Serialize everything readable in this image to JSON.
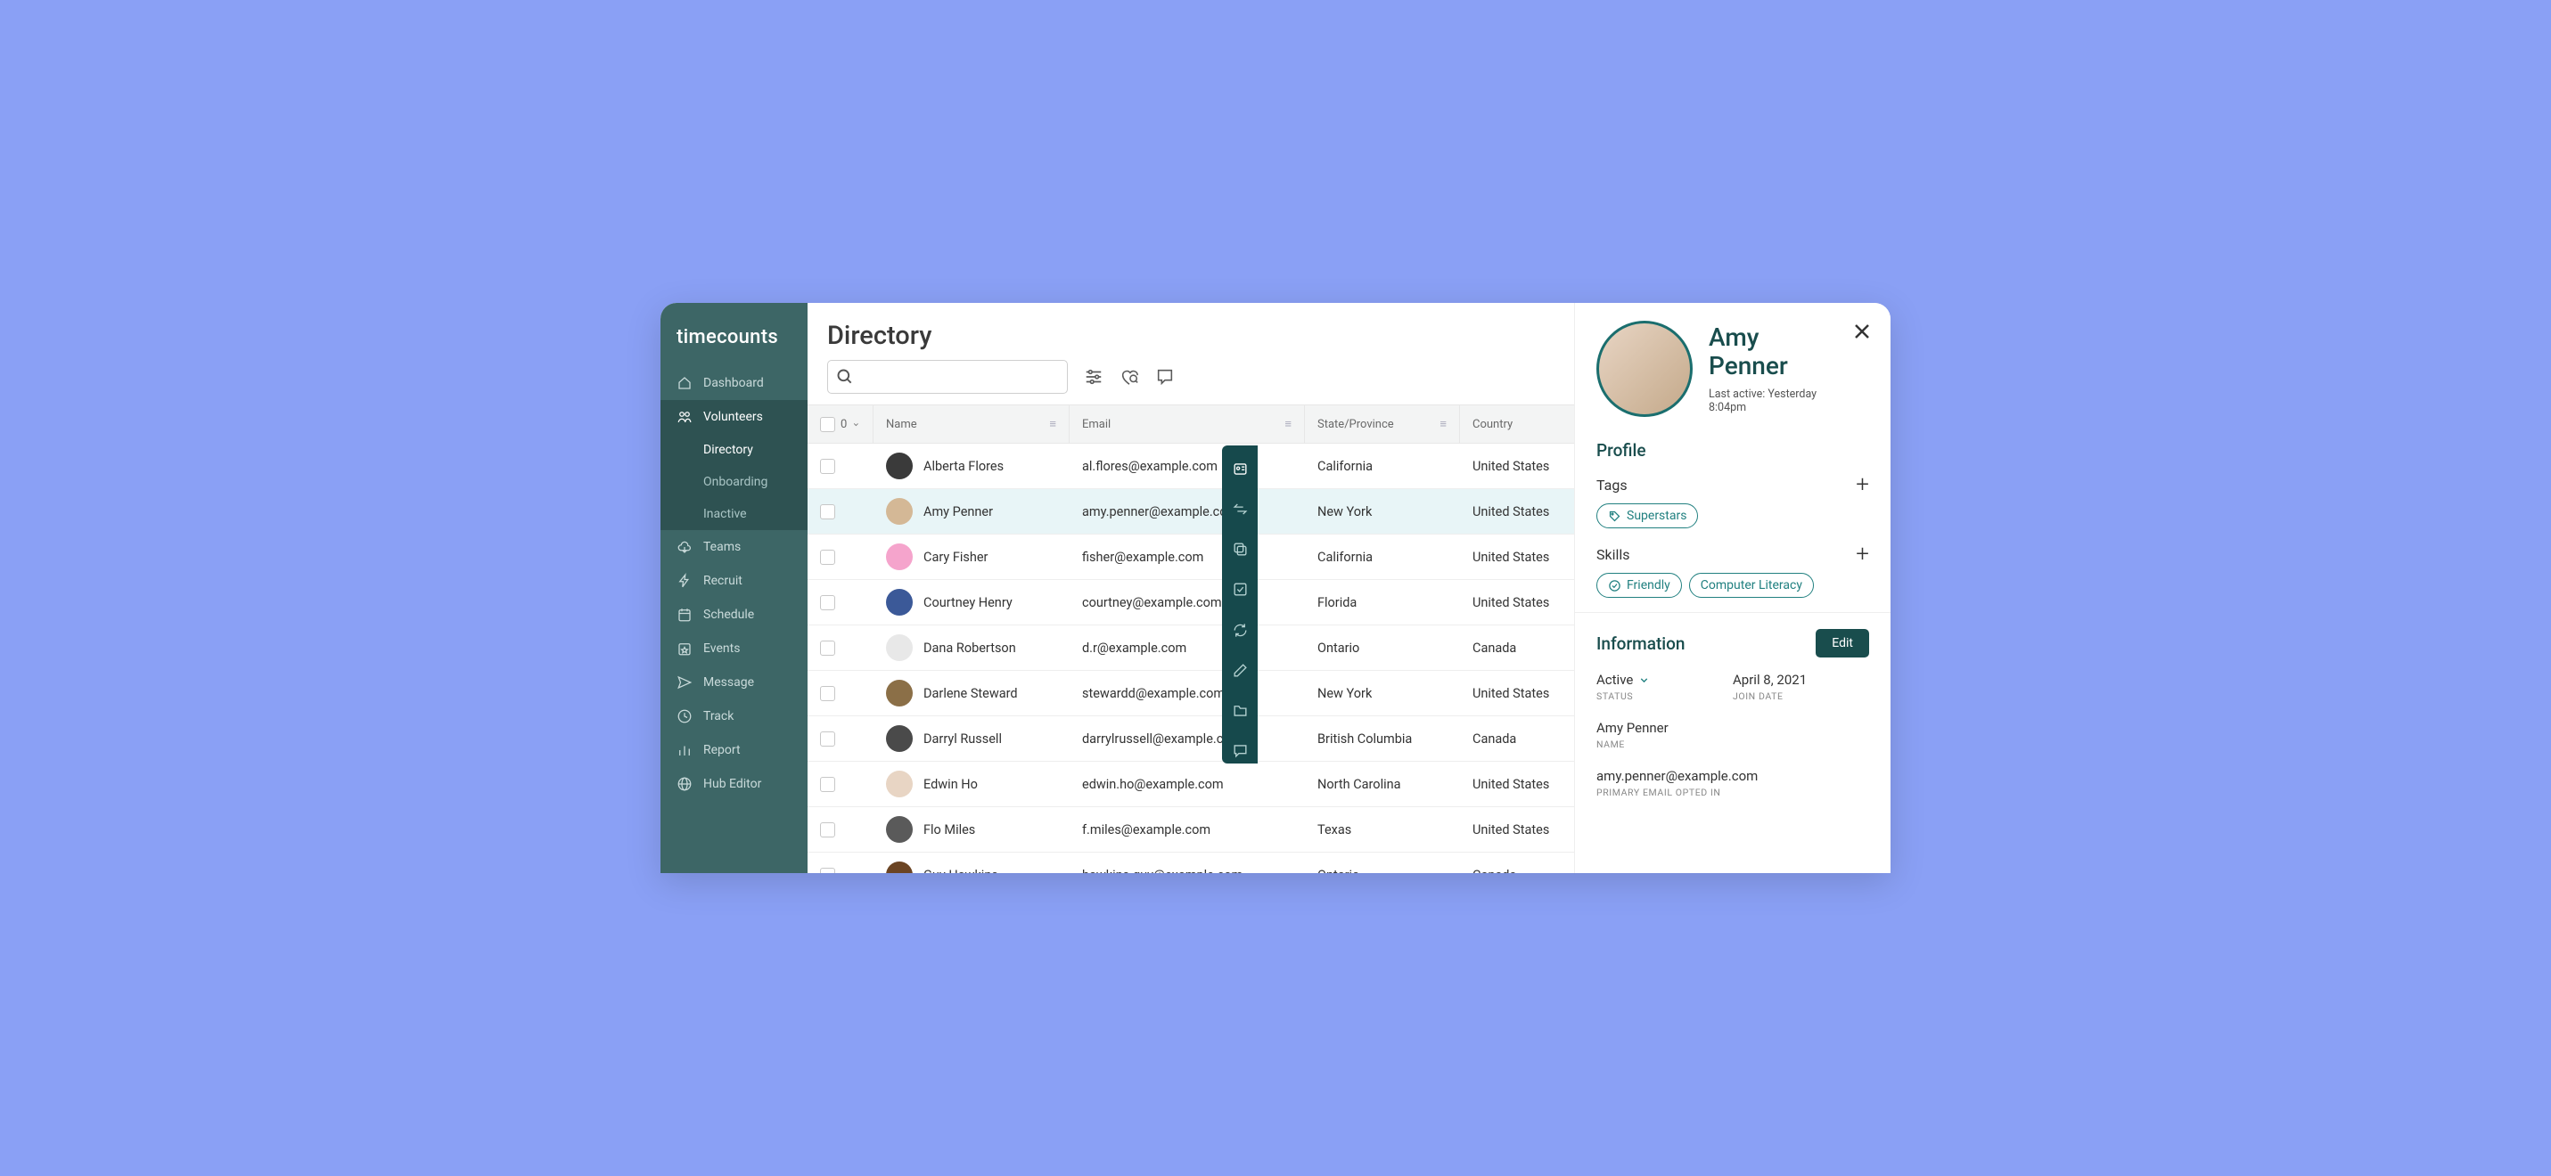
{
  "brand": "timecounts",
  "sidebar": {
    "items": [
      {
        "label": "Dashboard",
        "icon": "home"
      },
      {
        "label": "Volunteers",
        "icon": "users",
        "active": true,
        "sub": [
          {
            "label": "Directory",
            "selected": true
          },
          {
            "label": "Onboarding"
          },
          {
            "label": "Inactive"
          }
        ]
      },
      {
        "label": "Teams",
        "icon": "cloud"
      },
      {
        "label": "Recruit",
        "icon": "bolt"
      },
      {
        "label": "Schedule",
        "icon": "calendar"
      },
      {
        "label": "Events",
        "icon": "star-cal"
      },
      {
        "label": "Message",
        "icon": "send"
      },
      {
        "label": "Track",
        "icon": "clock"
      },
      {
        "label": "Report",
        "icon": "chart"
      },
      {
        "label": "Hub Editor",
        "icon": "globe"
      }
    ]
  },
  "page": {
    "title": "Directory",
    "selected_count": "0"
  },
  "columns": [
    "Name",
    "Email",
    "State/Province",
    "Country"
  ],
  "rows": [
    {
      "name": "Alberta Flores",
      "email": "al.flores@example.com",
      "state": "California",
      "country": "United States",
      "av": "#3a3a3a"
    },
    {
      "name": "Amy Penner",
      "email": "amy.penner@example.com",
      "state": "New York",
      "country": "United States",
      "selected": true,
      "av": "#d4b896"
    },
    {
      "name": "Cary Fisher",
      "email": "fisher@example.com",
      "state": "California",
      "country": "United States",
      "av": "#f5a4cc"
    },
    {
      "name": "Courtney Henry",
      "email": "courtney@example.com",
      "state": "Florida",
      "country": "United States",
      "av": "#3b5998"
    },
    {
      "name": "Dana Robertson",
      "email": "d.r@example.com",
      "state": "Ontario",
      "country": "Canada",
      "av": "#e8e8e8"
    },
    {
      "name": "Darlene Steward",
      "email": "stewardd@example.com",
      "state": "New York",
      "country": "United States",
      "av": "#8b6f47"
    },
    {
      "name": "Darryl Russell",
      "email": "darrylrussell@example.com",
      "state": "British Columbia",
      "country": "Canada",
      "av": "#4a4a4a"
    },
    {
      "name": "Edwin Ho",
      "email": "edwin.ho@example.com",
      "state": "North Carolina",
      "country": "United States",
      "av": "#e8d5c4"
    },
    {
      "name": "Flo Miles",
      "email": "f.miles@example.com",
      "state": "Texas",
      "country": "United States",
      "av": "#5a5a5a"
    },
    {
      "name": "Guy Hawkins",
      "email": "hawkins.guy@example.com",
      "state": "Ontario",
      "country": "Canada",
      "av": "#6b4423"
    }
  ],
  "rail": [
    "id-card",
    "swap",
    "copy",
    "check-sq",
    "refresh",
    "edit",
    "folder",
    "chat"
  ],
  "panel": {
    "name_first": "Amy",
    "name_last": "Penner",
    "last_active_label": "Last active: Yesterday 8:04pm",
    "profile_heading": "Profile",
    "tags_heading": "Tags",
    "tags": [
      "Superstars"
    ],
    "skills_heading": "Skills",
    "skills": [
      "Friendly",
      "Computer Literacy"
    ],
    "info_heading": "Information",
    "edit_label": "Edit",
    "status_value": "Active",
    "status_label": "STATUS",
    "join_value": "April 8, 2021",
    "join_label": "JOIN DATE",
    "name_value": "Amy Penner",
    "name_label": "NAME",
    "email_value": "amy.penner@example.com",
    "email_label": "PRIMARY EMAIL OPTED IN"
  }
}
